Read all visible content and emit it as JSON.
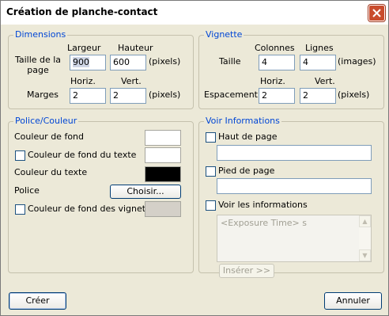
{
  "window": {
    "title": "Création de planche-contact"
  },
  "dimensions": {
    "legend": "Dimensions",
    "largeur_label": "Largeur",
    "hauteur_label": "Hauteur",
    "taille_label": "Taille de la page",
    "width_value": "900",
    "height_value": "600",
    "unit1": "(pixels)",
    "horiz_label": "Horiz.",
    "vert_label": "Vert.",
    "marges_label": "Marges",
    "margin_h": "2",
    "margin_v": "2",
    "unit2": "(pixels)"
  },
  "vignette": {
    "legend": "Vignette",
    "colonnes_label": "Colonnes",
    "lignes_label": "Lignes",
    "taille_label": "Taille",
    "colonnes_value": "4",
    "lignes_value": "4",
    "unit1": "(images)",
    "horiz_label": "Horiz.",
    "vert_label": "Vert.",
    "espacement_label": "Espacement",
    "spacing_h": "2",
    "spacing_v": "2",
    "unit2": "(pixels)"
  },
  "police": {
    "legend": "Police/Couleur",
    "bg_color_label": "Couleur de fond",
    "bg_color": "#ffffff",
    "text_bg_label": "Couleur de fond du texte",
    "text_bg_color": "#ffffff",
    "text_color_label": "Couleur du texte",
    "text_color": "#000000",
    "police_label": "Police",
    "choisir_button": "Choisir...",
    "thumb_bg_label": "Couleur de fond des vignettes",
    "thumb_bg_color": "#d4d0c8"
  },
  "info": {
    "legend": "Voir Informations",
    "header_label": "Haut de page",
    "header_value": "",
    "footer_label": "Pied de page",
    "footer_value": "",
    "show_info_label": "Voir les informations",
    "info_text": "<Exposure Time> s",
    "insert_button": "Insérer >>"
  },
  "footer": {
    "create_button": "Créer",
    "cancel_button": "Annuler"
  }
}
